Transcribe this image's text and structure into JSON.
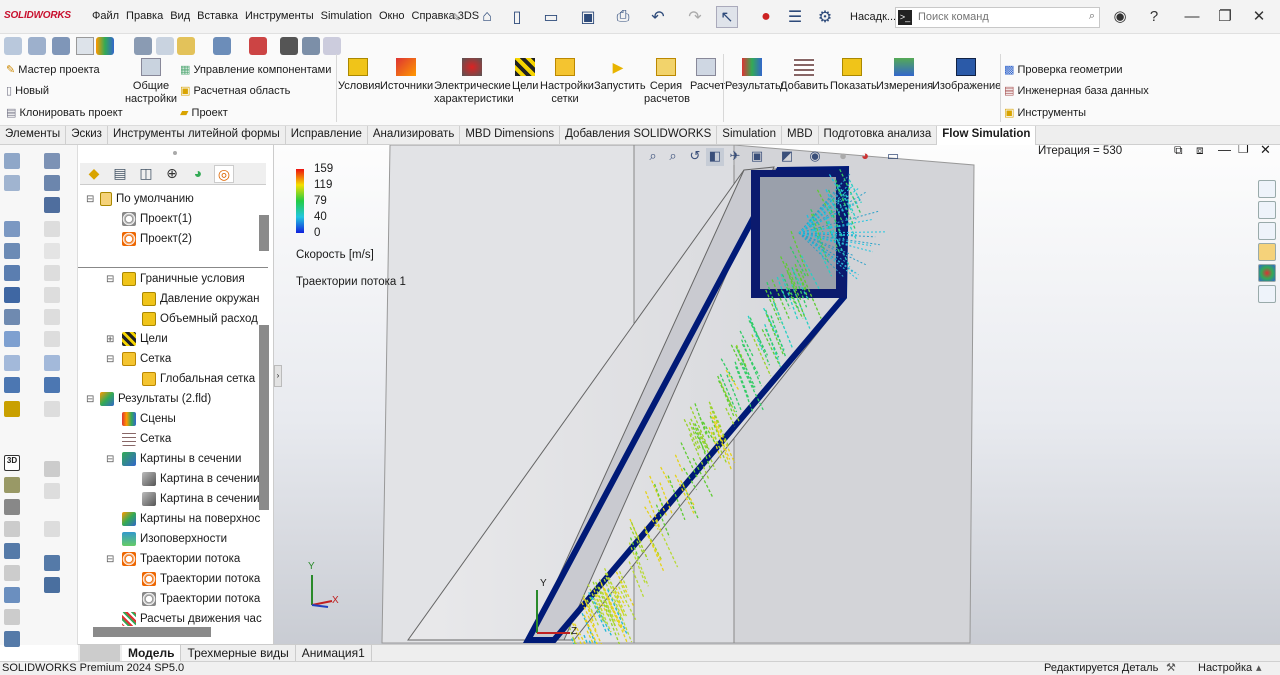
{
  "app": {
    "brand": "SOLIDWORKS",
    "menu": [
      "Файл",
      "Правка",
      "Вид",
      "Вставка",
      "Инструменты",
      "Simulation",
      "Окно",
      "Справка 3DS"
    ],
    "settings_label": "Насадк...",
    "search_placeholder": "Поиск команд",
    "cmd_prompt": ">_"
  },
  "toolbar": {
    "left_items": [
      "Мастер проекта",
      "Новый",
      "Клонировать проект"
    ],
    "general_settings": "Общие настройки",
    "component_items": [
      "Управление компонентами",
      "Расчетная область",
      "Проект"
    ],
    "buttons": [
      {
        "label": "Условия",
        "icon": "conditions-icon"
      },
      {
        "label": "Источники",
        "icon": "sources-icon"
      },
      {
        "label": "Электрические характеристики",
        "icon": "electrical-icon"
      },
      {
        "label": "Цели",
        "icon": "goals-icon"
      },
      {
        "label": "Настройки сетки",
        "icon": "mesh-settings-icon"
      },
      {
        "label": "Запустить",
        "icon": "run-icon"
      },
      {
        "label": "Серия расчетов",
        "icon": "batch-run-icon"
      },
      {
        "label": "Расчет",
        "icon": "calc-icon"
      },
      {
        "label": "Результаты",
        "icon": "results-icon"
      },
      {
        "label": "Добавить",
        "icon": "add-icon"
      },
      {
        "label": "Показать",
        "icon": "show-icon"
      },
      {
        "label": "Измерения",
        "icon": "measure-icon"
      },
      {
        "label": "Изображение",
        "icon": "image-icon"
      }
    ],
    "right_items": [
      "Проверка геометрии",
      "Инженерная база данных",
      "Инструменты"
    ]
  },
  "tabs": [
    "Элементы",
    "Эскиз",
    "Инструменты литейной формы",
    "Исправление",
    "Анализировать",
    "MBD Dimensions",
    "Добавления SOLIDWORKS",
    "Simulation",
    "MBD",
    "Подготовка анализа",
    "Flow Simulation"
  ],
  "active_tab": "Flow Simulation",
  "tree": {
    "nodes": [
      {
        "label": "По умолчанию",
        "indent": 1,
        "icon": "config-icon"
      },
      {
        "label": "Проект(1)",
        "indent": 2,
        "icon": "project-icon"
      },
      {
        "label": "Проект(2)",
        "indent": 2,
        "icon": "project-active-icon"
      },
      {
        "label": "Граничные условия",
        "indent": 2,
        "icon": "boundary-icon"
      },
      {
        "label": "Давление окружан",
        "indent": 3,
        "icon": "pressure-icon"
      },
      {
        "label": "Объемный расход",
        "indent": 3,
        "icon": "flowrate-icon"
      },
      {
        "label": "Цели",
        "indent": 2,
        "icon": "goals-icon"
      },
      {
        "label": "Сетка",
        "indent": 2,
        "icon": "mesh-icon"
      },
      {
        "label": "Глобальная сетка",
        "indent": 3,
        "icon": "global-mesh-icon"
      },
      {
        "label": "Результаты (2.fld)",
        "indent": 1,
        "icon": "results-folder-icon"
      },
      {
        "label": "Сцены",
        "indent": 2,
        "icon": "scenes-icon"
      },
      {
        "label": "Сетка",
        "indent": 2,
        "icon": "mesh-grid-icon"
      },
      {
        "label": "Картины в сечении",
        "indent": 2,
        "icon": "cut-plots-icon"
      },
      {
        "label": "Картина в сечении",
        "indent": 3,
        "icon": "cut-plot-icon"
      },
      {
        "label": "Картина в сечении",
        "indent": 3,
        "icon": "cut-plot-icon"
      },
      {
        "label": "Картины на поверхнос",
        "indent": 2,
        "icon": "surface-plots-icon"
      },
      {
        "label": "Изоповерхности",
        "indent": 2,
        "icon": "isosurface-icon"
      },
      {
        "label": "Траектории потока",
        "indent": 2,
        "icon": "flow-traj-icon"
      },
      {
        "label": "Траектории потока",
        "indent": 3,
        "icon": "flow-traj-item-icon"
      },
      {
        "label": "Траектории потока",
        "indent": 3,
        "icon": "flow-traj-item-icon"
      },
      {
        "label": "Расчеты движения час",
        "indent": 2,
        "icon": "particle-icon"
      }
    ]
  },
  "viewport": {
    "legend_ticks": [
      "159",
      "119",
      "79",
      "40",
      "0"
    ],
    "legend_title": "Скорость [m/s]",
    "plot_title": "Траектории потока 1",
    "iteration": "Итерация = 530",
    "axis_labels": [
      "Y",
      "X",
      "Z"
    ]
  },
  "bottom_tabs": [
    "Модель",
    "Трехмерные виды",
    "Анимация1"
  ],
  "status": {
    "product": "SOLIDWORKS Premium 2024 SP5.0",
    "editing": "Редактируется Деталь",
    "custom": "Настройка"
  }
}
